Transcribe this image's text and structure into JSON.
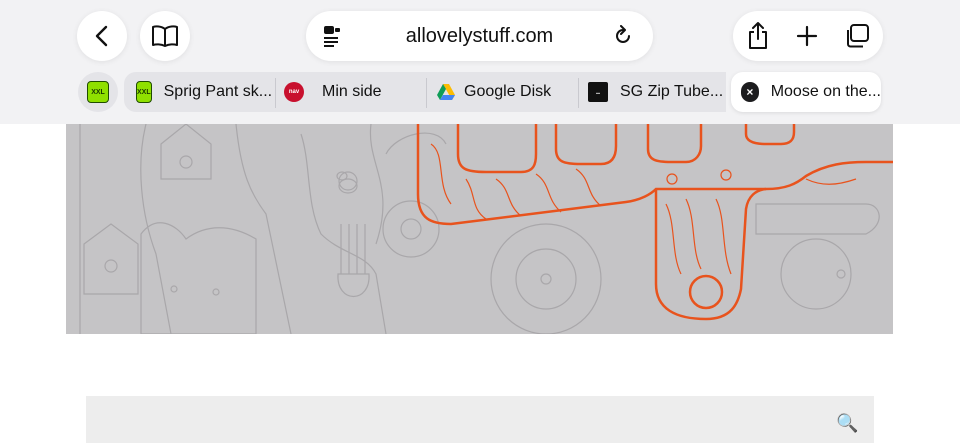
{
  "address_bar": {
    "url": "allovelystuff.com"
  },
  "tabs": [
    {
      "label": "Sprig Pant sk...",
      "favicon": "xxl-favicon"
    },
    {
      "label": "Min side",
      "favicon": "nav-favicon"
    },
    {
      "label": "Google Disk",
      "favicon": "google-drive-favicon"
    },
    {
      "label": "SG Zip Tube...",
      "favicon": "sg-favicon"
    },
    {
      "label": "Moose on the...",
      "favicon": "close-icon"
    }
  ],
  "pinned_tab": {
    "favicon": "xxl-favicon",
    "badge": "XXL"
  },
  "favicon_text": {
    "xxl": "XXL",
    "nav": "nav"
  },
  "colors": {
    "accent_orange": "#e8531d",
    "hero_bg": "#c5c4c6",
    "toolbar_bg": "#f2f2f4"
  },
  "icons": {
    "back": "chevron-left-icon",
    "reader": "book-icon",
    "page_menu": "page-menu-icon",
    "reload": "reload-icon",
    "share": "share-icon",
    "new_tab": "plus-icon",
    "tabs": "tabs-icon",
    "search": "search-icon"
  }
}
